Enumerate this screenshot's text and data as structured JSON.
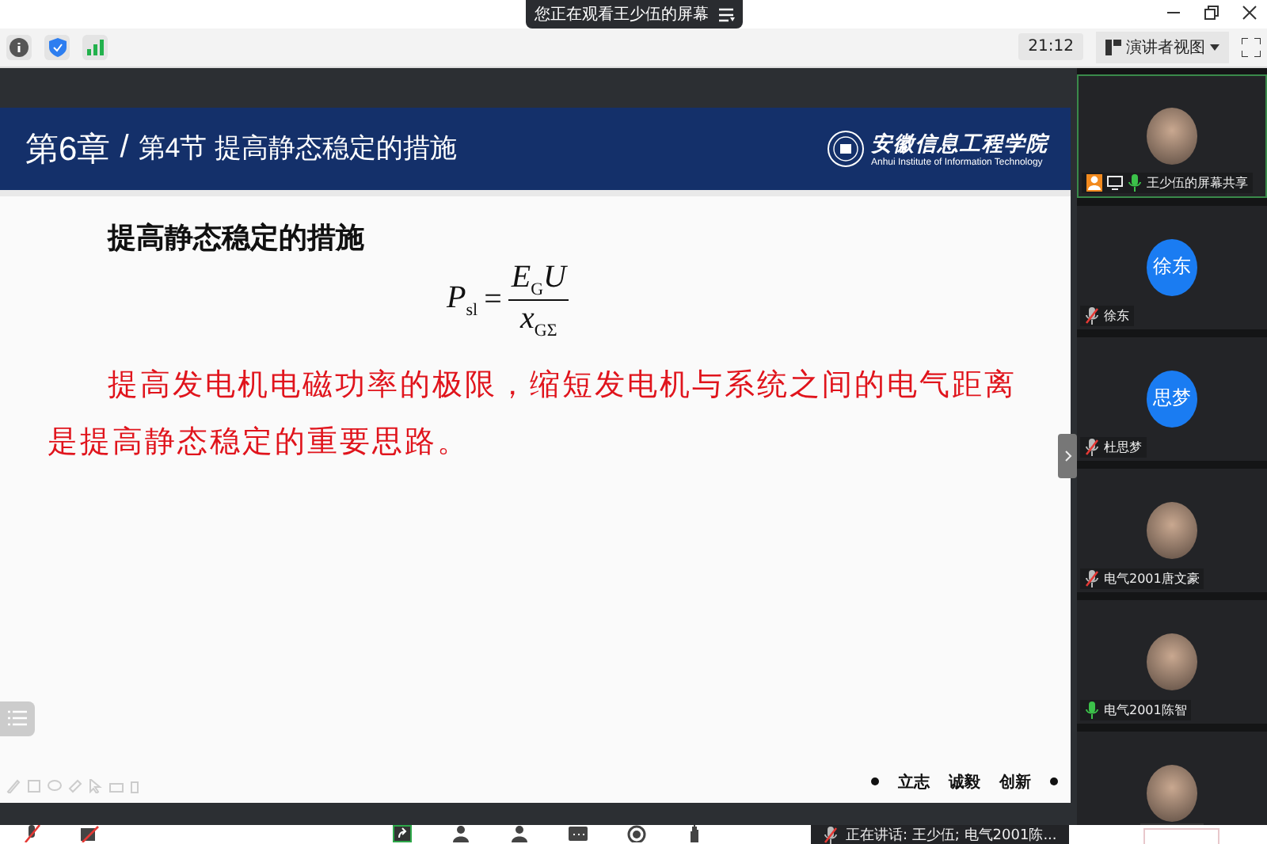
{
  "banner": {
    "text": "您正在观看王少伍的屏幕"
  },
  "toolbar": {
    "time": "21:12",
    "view_button": "演讲者视图"
  },
  "slide": {
    "chapter": "第6章",
    "separator": "/",
    "section": "第4节 提高静态稳定的措施",
    "school_name": "安徽信息工程学院",
    "school_name_en": "Anhui Institute of Information Technology",
    "heading": "提高静态稳定的措施",
    "formula": {
      "lhs": "*P*$_{sl}$",
      "equals": "=",
      "numerator": "*E*$_{G}$*U*",
      "denominator": "*x*$_{GΣ}$"
    },
    "paragraph": "提高发电机电磁功率的极限，缩短发电机与系统之间的电气距离是提高静态稳定的重要思路。",
    "motto": [
      "立志",
      "诚毅",
      "创新"
    ]
  },
  "participants": [
    {
      "kind": "photo",
      "name": "王少伍的屏幕共享",
      "muted": false,
      "sharing": true,
      "highlighted": true
    },
    {
      "kind": "initials",
      "initials": "徐东",
      "name": "徐东",
      "muted": true,
      "sharing": false,
      "highlighted": false
    },
    {
      "kind": "initials",
      "initials": "思梦",
      "name": "杜思梦",
      "muted": true,
      "sharing": false,
      "highlighted": false
    },
    {
      "kind": "photo",
      "name": "电气2001唐文豪",
      "muted": true,
      "sharing": false,
      "highlighted": false
    },
    {
      "kind": "photo",
      "name": "电气2001陈智",
      "muted": false,
      "sharing": false,
      "highlighted": false
    },
    {
      "kind": "photo",
      "sharing": false,
      "highlighted": false
    }
  ],
  "speaking": "正在讲话: 王少伍; 电气2001陈..."
}
